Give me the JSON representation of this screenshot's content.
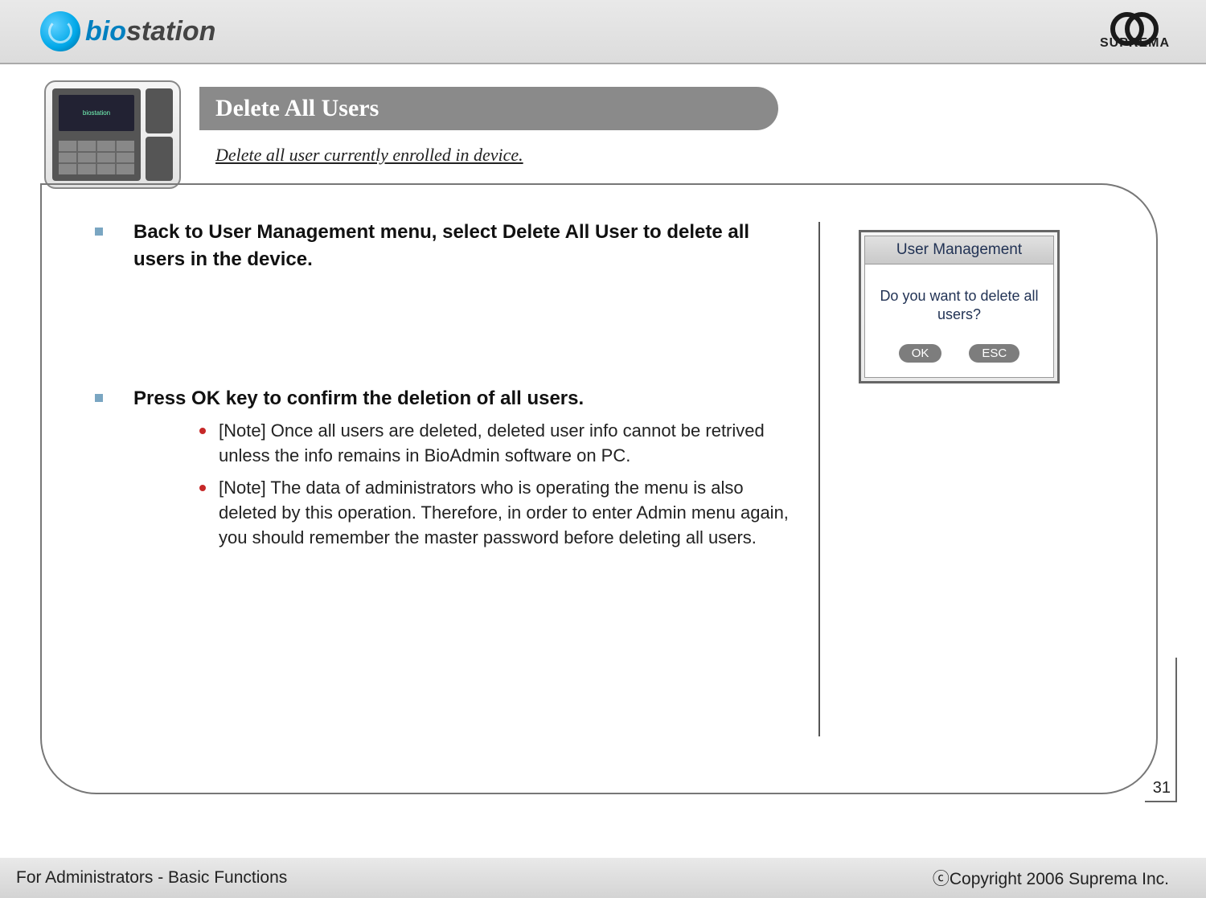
{
  "header": {
    "logo_left": "biostation",
    "logo_right": "SUPREMA"
  },
  "title": "Delete All Users",
  "subtitle": "Delete all user currently enrolled in device.",
  "bullets": [
    {
      "head": "Back to User Management menu, select Delete All User to delete all users in the device.",
      "subs": []
    },
    {
      "head": "Press OK key to confirm the deletion of all users.",
      "subs": [
        "[Note] Once all users are deleted, deleted user info cannot be retrived unless the info remains in BioAdmin software on PC.",
        "[Note] The data of administrators who is operating the menu is also deleted by this operation. Therefore, in order to enter Admin menu again, you should remember the master password before deleting all users."
      ]
    }
  ],
  "device_screen": {
    "title": "User Management",
    "message": "Do you want to delete all users?",
    "ok": "OK",
    "esc": "ESC"
  },
  "footer": {
    "left": "For Administrators - Basic Functions",
    "right": "ⓒCopyright 2006 Suprema Inc."
  },
  "page_number": "31"
}
